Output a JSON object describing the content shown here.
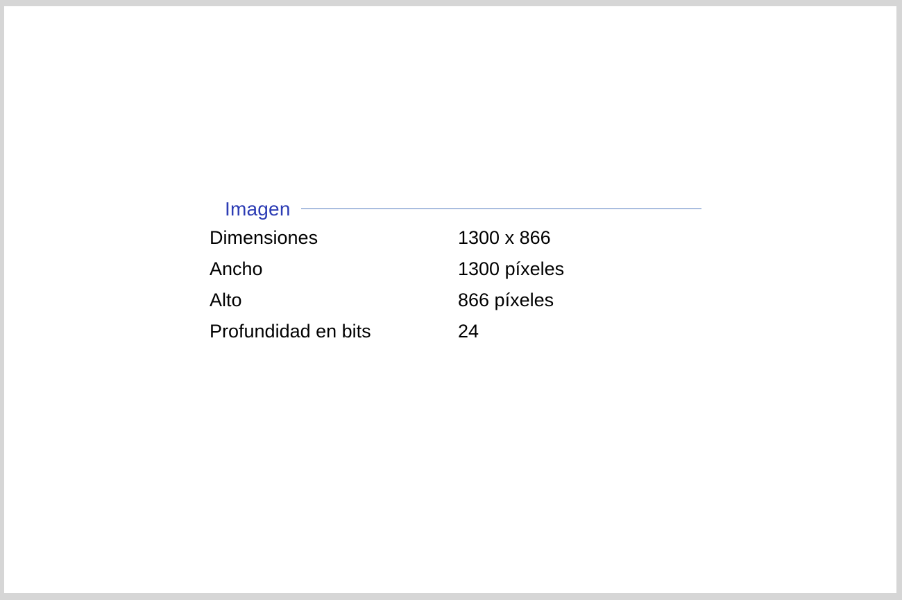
{
  "section": {
    "title": "Imagen"
  },
  "properties": [
    {
      "label": "Dimensiones",
      "value": "1300 x 866"
    },
    {
      "label": "Ancho",
      "value": "1300 píxeles"
    },
    {
      "label": "Alto",
      "value": "866 píxeles"
    },
    {
      "label": "Profundidad en bits",
      "value": "24"
    }
  ],
  "colors": {
    "section_title": "#2c3cb4",
    "section_rule": "#a9bddf",
    "text": "#000000",
    "background": "#ffffff",
    "frame_border": "#d6d6d6"
  }
}
